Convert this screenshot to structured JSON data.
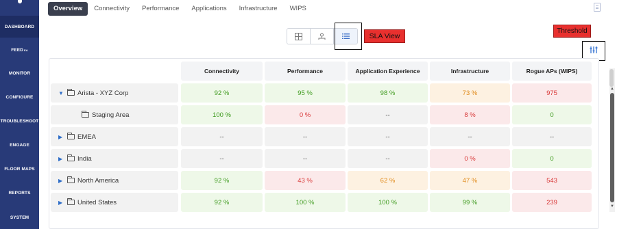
{
  "sidebar": {
    "items": [
      {
        "label": "DASHBOARD",
        "active": true
      },
      {
        "label": "FEED",
        "badge": "EA"
      },
      {
        "label": "MONITOR"
      },
      {
        "label": "CONFIGURE"
      },
      {
        "label": "TROUBLESHOOT"
      },
      {
        "label": "ENGAGE"
      },
      {
        "label": "FLOOR MAPS"
      },
      {
        "label": "REPORTS"
      },
      {
        "label": "SYSTEM"
      }
    ]
  },
  "tabs": [
    "Overview",
    "Connectivity",
    "Performance",
    "Applications",
    "Infrastructure",
    "WIPS"
  ],
  "view_toggle": {
    "icons": [
      "grid-icon",
      "hierarchy-icon",
      "list-icon"
    ],
    "selected": "list-icon"
  },
  "annotations": {
    "sla_view": "SLA View",
    "threshold": "Threshold"
  },
  "table": {
    "columns": [
      "Connectivity",
      "Performance",
      "Application Experience",
      "Infrastructure",
      "Rogue APs (WIPS)"
    ],
    "rows": [
      {
        "name": "Arista - XYZ Corp",
        "expanded": true,
        "indent": 0,
        "folder": "folder",
        "values": [
          "92 %",
          "95 %",
          "98 %",
          "73 %",
          "975"
        ],
        "status": [
          "green",
          "green",
          "green",
          "orange",
          "red"
        ]
      },
      {
        "name": "Staging Area",
        "expanded": null,
        "indent": 1,
        "folder": "folder-open",
        "values": [
          "100 %",
          "0 %",
          "--",
          "8 %",
          "0"
        ],
        "status": [
          "green",
          "red",
          "grey",
          "red",
          "green"
        ]
      },
      {
        "name": "EMEA",
        "expanded": false,
        "indent": 0,
        "folder": "folder",
        "values": [
          "--",
          "--",
          "--",
          "--",
          "--"
        ],
        "status": [
          "grey",
          "grey",
          "grey",
          "grey",
          "grey"
        ]
      },
      {
        "name": "India",
        "expanded": false,
        "indent": 0,
        "folder": "folder",
        "values": [
          "--",
          "--",
          "--",
          "0 %",
          "0"
        ],
        "status": [
          "grey",
          "grey",
          "grey",
          "red",
          "green"
        ]
      },
      {
        "name": "North America",
        "expanded": false,
        "indent": 0,
        "folder": "folder",
        "values": [
          "92 %",
          "43 %",
          "62 %",
          "47 %",
          "543"
        ],
        "status": [
          "green",
          "red",
          "orange",
          "orange",
          "red"
        ]
      },
      {
        "name": "United States",
        "expanded": false,
        "indent": 0,
        "folder": "folder",
        "values": [
          "92 %",
          "100 %",
          "100 %",
          "99 %",
          "239"
        ],
        "status": [
          "green",
          "green",
          "green",
          "green",
          "red"
        ]
      }
    ]
  },
  "colors": {
    "sidebar": "#283a78",
    "accent": "#2f6ec8",
    "annotation_red": "#e8302e"
  }
}
